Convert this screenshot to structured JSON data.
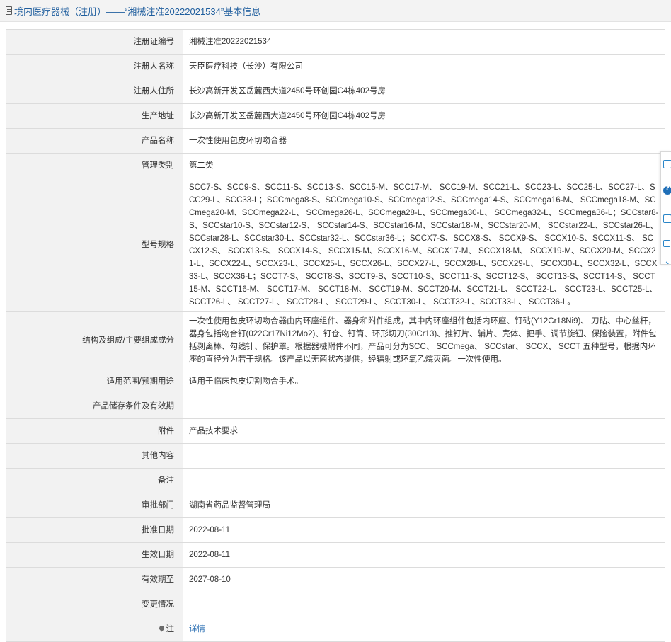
{
  "header": {
    "title": "境内医疗器械（注册）——“湘械注准20222021534”基本信息"
  },
  "rows": [
    {
      "label": "注册证编号",
      "value": "湘械注准20222021534"
    },
    {
      "label": "注册人名称",
      "value": "天臣医疗科技（长沙）有限公司"
    },
    {
      "label": "注册人住所",
      "value": "长沙高新开发区岳麓西大道2450号环创园C4栋402号房"
    },
    {
      "label": "生产地址",
      "value": "长沙高新开发区岳麓西大道2450号环创园C4栋402号房"
    },
    {
      "label": "产品名称",
      "value": "一次性使用包皮环切吻合器"
    },
    {
      "label": "管理类别",
      "value": "第二类"
    },
    {
      "label": "型号规格",
      "value": "SCC7-S、SCC9-S、SCC11-S、SCC13-S、SCC15-M、SCC17-M、 SCC19-M、SCC21-L、SCC23-L、SCC25-L、SCC27-L、SCC29-L、SCC33-L；SCCmega8-S、SCCmega10-S、SCCmega12-S、SCCmega14-S、SCCmega16-M、 SCCmega18-M、SCCmega20-M、SCCmega22-L、 SCCmega26-L、SCCmega28-L、SCCmega30-L、 SCCmega32-L、 SCCmega36-L；SCCstar8-S、SCCstar10-S、SCCstar12-S、 SCCstar14-S、SCCstar16-M、SCCstar18-M、SCCstar20-M、 SCCstar22-L、SCCstar26-L、SCCstar28-L、SCCstar30-L、SCCstar32-L、SCCstar36-L；SCCX7-S、SCCX8-S、 SCCX9-S、 SCCX10-S、SCCX11-S、 SCCX12-S、 SCCX13-S、 SCCX14-S、 SCCX15-M、SCCX16-M、SCCX17-M、 SCCX18-M、 SCCX19-M、SCCX20-M、SCCX21-L、SCCX22-L、SCCX23-L、SCCX25-L、SCCX26-L、SCCX27-L、SCCX28-L、SCCX29-L、 SCCX30-L、SCCX32-L、SCCX33-L、SCCX36-L；SCCT7-S、 SCCT8-S、SCCT9-S、SCCT10-S、SCCT11-S、SCCT12-S、 SCCT13-S、SCCT14-S、 SCCT15-M、SCCT16-M、 SCCT17-M、 SCCT18-M、 SCCT19-M、SCCT20-M、SCCT21-L、 SCCT22-L、 SCCT23-L、SCCT25-L、 SCCT26-L、 SCCT27-L、 SCCT28-L、 SCCT29-L、 SCCT30-L、 SCCT32-L、SCCT33-L、 SCCT36-L。"
    },
    {
      "label": "结构及组成/主要组成成分",
      "value": "一次性使用包皮环切吻合器由内环座组件、器身和附件组成，其中内环座组件包括内环座、钉砧(Y12Cr18Ni9)、 刀砧、中心丝杆，器身包括吻合钉(022Cr17Ni12Mo2)、钉仓、钉筒、环形切刀(30Cr13)、推钉片、辅片、壳体、把手、调节旋钮、保险装置，附件包括剥离棒、勾线针、保护罩。根据器械附件不同，产品可分为SCC、 SCCmega、 SCCstar、 SCCX、 SCCT 五种型号，根据内环座的直径分为若干规格。该产品以无菌状态提供，经辐射或环氧乙烷灭菌。一次性使用。"
    },
    {
      "label": "适用范围/预期用途",
      "value": "适用于临床包皮切割吻合手术。"
    },
    {
      "label": "产品储存条件及有效期",
      "value": ""
    },
    {
      "label": "附件",
      "value": "产品技术要求"
    },
    {
      "label": "其他内容",
      "value": ""
    },
    {
      "label": "备注",
      "value": ""
    },
    {
      "label": "审批部门",
      "value": "湖南省药品监督管理局"
    },
    {
      "label": "批准日期",
      "value": "2022-08-11"
    },
    {
      "label": "生效日期",
      "value": "2022-08-11"
    },
    {
      "label": "有效期至",
      "value": "2027-08-10"
    },
    {
      "label": "变更情况",
      "value": ""
    }
  ],
  "note": {
    "label": "注",
    "link": "详情",
    "icon": "pin-icon"
  },
  "side_tools": [
    "document-icon",
    "help-icon",
    "image-icon",
    "copy-icon",
    "collapse-arrow-icon"
  ],
  "colors": {
    "link": "#2b6fb3",
    "header_text": "#1f5e9e",
    "label_bg": "#f2f2f2",
    "border": "#dcdcdc"
  }
}
